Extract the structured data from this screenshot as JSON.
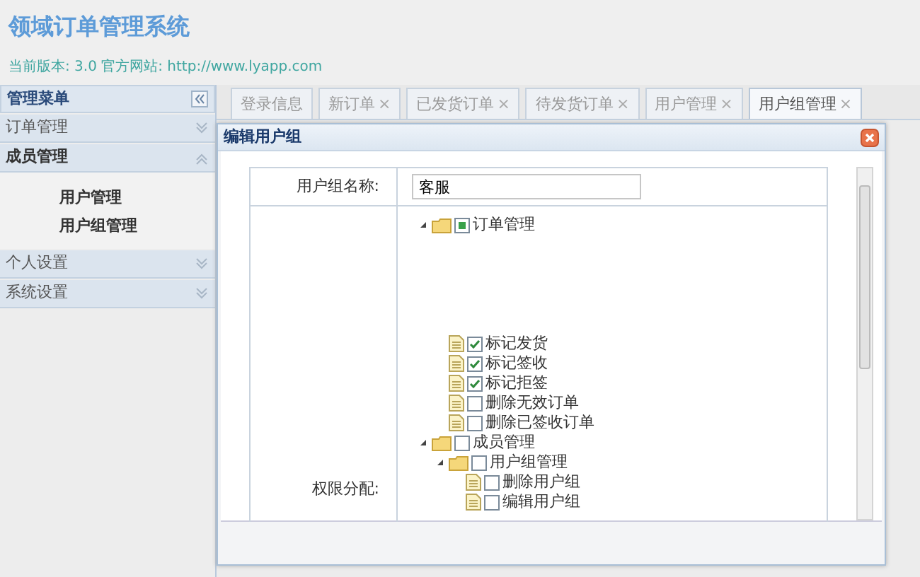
{
  "header": {
    "title": "领域订单管理系统",
    "subtitle": "当前版本: 3.0 官方网站: http://www.lyapp.com"
  },
  "sidebar": {
    "title": "管理菜单",
    "sections": [
      {
        "label": "订单管理",
        "expanded": false
      },
      {
        "label": "成员管理",
        "expanded": true,
        "items": [
          "用户管理",
          "用户组管理"
        ]
      },
      {
        "label": "个人设置",
        "expanded": false
      },
      {
        "label": "系统设置",
        "expanded": false
      }
    ]
  },
  "tabs": [
    {
      "label": "登录信息",
      "selected": false
    },
    {
      "label": "新订单",
      "close": "×",
      "selected": false
    },
    {
      "label": "已发货订单",
      "close": "×",
      "selected": false
    },
    {
      "label": "待发货订单",
      "close": "×",
      "selected": false
    },
    {
      "label": "用户管理",
      "close": "×",
      "selected": false
    },
    {
      "label": "用户组管理",
      "close": "×",
      "selected": true
    }
  ],
  "dialog": {
    "title": "编辑用户组",
    "fields": [
      {
        "label": "用户组名称:",
        "kind": "input",
        "value": "客服"
      },
      {
        "label": "权限分配:",
        "kind": "tree",
        "tree": [
          {
            "kind": "folder",
            "label": "订单管理",
            "expanded": true,
            "checked": false,
            "partial": true,
            "children": [
              {
                "kind": "leaf",
                "label": "标记发货",
                "checked": true
              },
              {
                "kind": "leaf",
                "label": "标记签收",
                "checked": true
              },
              {
                "kind": "leaf",
                "label": "标记拒签",
                "checked": true
              },
              {
                "kind": "leaf",
                "label": "删除无效订单",
                "checked": false
              },
              {
                "kind": "leaf",
                "label": "删除已签收订单",
                "checked": false
              }
            ]
          },
          {
            "kind": "folder",
            "label": "成员管理",
            "expanded": true,
            "checked": false,
            "children": [
              {
                "kind": "folder",
                "label": "用户组管理",
                "expanded": true,
                "checked": false,
                "children": [
                  {
                    "kind": "leaf",
                    "label": "删除用户组",
                    "checked": false
                  },
                  {
                    "kind": "leaf",
                    "label": "编辑用户组",
                    "checked": false
                  }
                ]
              }
            ]
          }
        ]
      }
    ]
  }
}
